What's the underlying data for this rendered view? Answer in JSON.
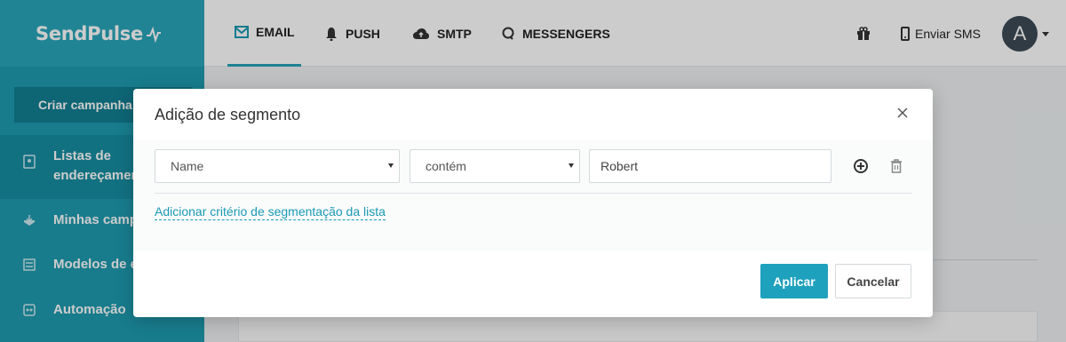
{
  "app": {
    "logo": "SendPulse"
  },
  "sidebar": {
    "create_label": "Criar campanha",
    "items": [
      {
        "label": "Listas de endereçamento",
        "icon": "address-list-icon"
      },
      {
        "label": "Minhas campanhas",
        "icon": "campaigns-icon"
      },
      {
        "label": "Modelos de e-mail",
        "icon": "templates-icon"
      },
      {
        "label": "Automação",
        "icon": "automation-icon"
      }
    ]
  },
  "topbar": {
    "tabs": [
      {
        "label": "EMAIL",
        "icon": "envelope-icon"
      },
      {
        "label": "PUSH",
        "icon": "bell-icon"
      },
      {
        "label": "SMTP",
        "icon": "cloud-upload-icon"
      },
      {
        "label": "MESSENGERS",
        "icon": "chat-icon"
      }
    ],
    "gift_icon": "gift-icon",
    "sms_label": "Enviar SMS",
    "avatar_letter": "A"
  },
  "modal": {
    "title": "Adição de segmento",
    "field_select": "Name",
    "operator_select": "contém",
    "value_input": "Robert",
    "add_criteria_link": "Adicionar critério de segmentação da lista",
    "apply_label": "Aplicar",
    "cancel_label": "Cancelar"
  },
  "colors": {
    "brand": "#1e9bb0",
    "accent": "#1ea1bd"
  }
}
